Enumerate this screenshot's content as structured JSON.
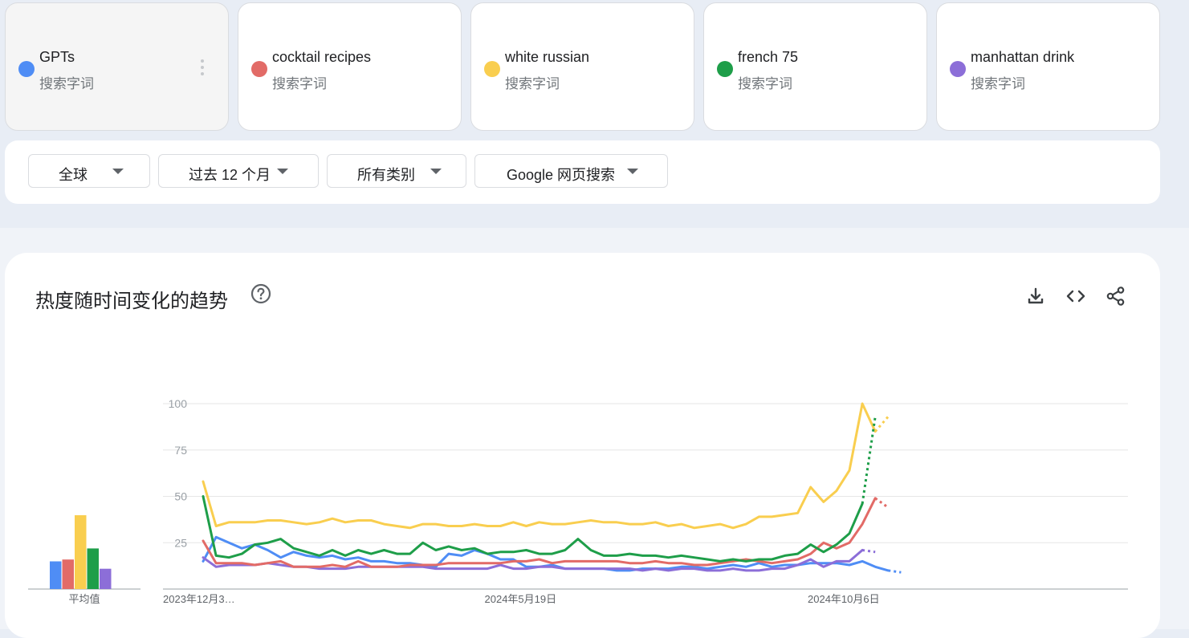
{
  "search_terms": [
    {
      "name": "GPTs",
      "type": "搜索字词",
      "color": "#4f8df5",
      "active": true
    },
    {
      "name": "cocktail recipes",
      "type": "搜索字词",
      "color": "#e26b67"
    },
    {
      "name": "white russian",
      "type": "搜索字词",
      "color": "#f9ce4f"
    },
    {
      "name": "french 75",
      "type": "搜索字词",
      "color": "#1e9e49"
    },
    {
      "name": "manhattan drink",
      "type": "搜索字词",
      "color": "#8c6ed8"
    }
  ],
  "filters": {
    "region": "全球",
    "time_range": "过去 12 个月",
    "category": "所有类别",
    "property": "Google 网页搜索"
  },
  "interest_panel": {
    "title": "热度随时间变化的趋势",
    "icons": [
      "help-icon",
      "download-icon",
      "embed-code-icon",
      "share-icon"
    ]
  },
  "chart_data": [
    {
      "type": "bar",
      "xlabel": "平均值",
      "categories": [
        "GPTs",
        "cocktail recipes",
        "white russian",
        "french 75",
        "manhattan drink"
      ],
      "values": [
        15,
        16,
        40,
        22,
        11
      ],
      "colors": [
        "#4f8df5",
        "#e26b67",
        "#f9ce4f",
        "#1e9e49",
        "#8c6ed8"
      ]
    },
    {
      "type": "line",
      "ylim": [
        0,
        100
      ],
      "yticks": [
        25,
        50,
        75,
        100
      ],
      "xtick_labels": [
        "2023年12月3…",
        "2024年5月19日",
        "2024年10月6日"
      ],
      "xtick_indices": [
        0,
        25,
        50
      ],
      "grid": true,
      "partial_last_point": true,
      "series": [
        {
          "name": "GPTs",
          "color": "#4f8df5",
          "values": [
            15,
            28,
            25,
            22,
            24,
            21,
            17,
            20,
            18,
            17,
            18,
            16,
            17,
            15,
            15,
            14,
            14,
            13,
            12,
            19,
            18,
            21,
            19,
            16,
            16,
            12,
            12,
            13,
            11,
            11,
            11,
            11,
            10,
            10,
            11,
            11,
            11,
            12,
            12,
            11,
            12,
            13,
            12,
            14,
            12,
            13,
            13,
            14,
            14,
            14,
            13,
            15,
            12,
            10,
            9
          ]
        },
        {
          "name": "cocktail recipes",
          "color": "#e26b67",
          "values": [
            26,
            14,
            14,
            14,
            13,
            14,
            15,
            12,
            12,
            12,
            13,
            12,
            15,
            12,
            12,
            12,
            13,
            13,
            13,
            14,
            14,
            14,
            14,
            14,
            15,
            15,
            16,
            14,
            15,
            15,
            15,
            15,
            15,
            14,
            14,
            15,
            14,
            14,
            13,
            13,
            14,
            15,
            16,
            15,
            14,
            15,
            16,
            19,
            25,
            22,
            25,
            35,
            49,
            44
          ]
        },
        {
          "name": "white russian",
          "color": "#f9ce4f",
          "values": [
            58,
            34,
            36,
            36,
            36,
            37,
            37,
            36,
            35,
            36,
            38,
            36,
            37,
            37,
            35,
            34,
            33,
            35,
            35,
            34,
            34,
            35,
            34,
            34,
            36,
            34,
            36,
            35,
            35,
            36,
            37,
            36,
            36,
            35,
            35,
            36,
            34,
            35,
            33,
            34,
            35,
            33,
            35,
            39,
            39,
            40,
            41,
            55,
            47,
            53,
            64,
            100,
            85,
            93
          ]
        },
        {
          "name": "french 75",
          "color": "#1e9e49",
          "values": [
            50,
            18,
            17,
            19,
            24,
            25,
            27,
            22,
            20,
            18,
            21,
            18,
            21,
            19,
            21,
            19,
            19,
            25,
            21,
            23,
            21,
            22,
            19,
            20,
            20,
            21,
            19,
            19,
            21,
            27,
            21,
            18,
            18,
            19,
            18,
            18,
            17,
            18,
            17,
            16,
            15,
            16,
            15,
            16,
            16,
            18,
            19,
            24,
            20,
            24,
            30,
            46,
            93
          ]
        },
        {
          "name": "manhattan drink",
          "color": "#8c6ed8",
          "values": [
            17,
            12,
            13,
            13,
            13,
            14,
            13,
            12,
            12,
            11,
            11,
            11,
            12,
            12,
            12,
            12,
            12,
            12,
            11,
            11,
            11,
            11,
            11,
            13,
            11,
            11,
            12,
            12,
            11,
            11,
            11,
            11,
            11,
            11,
            10,
            11,
            10,
            11,
            11,
            10,
            10,
            11,
            10,
            10,
            11,
            11,
            13,
            16,
            12,
            15,
            15,
            21,
            20
          ]
        }
      ]
    }
  ]
}
